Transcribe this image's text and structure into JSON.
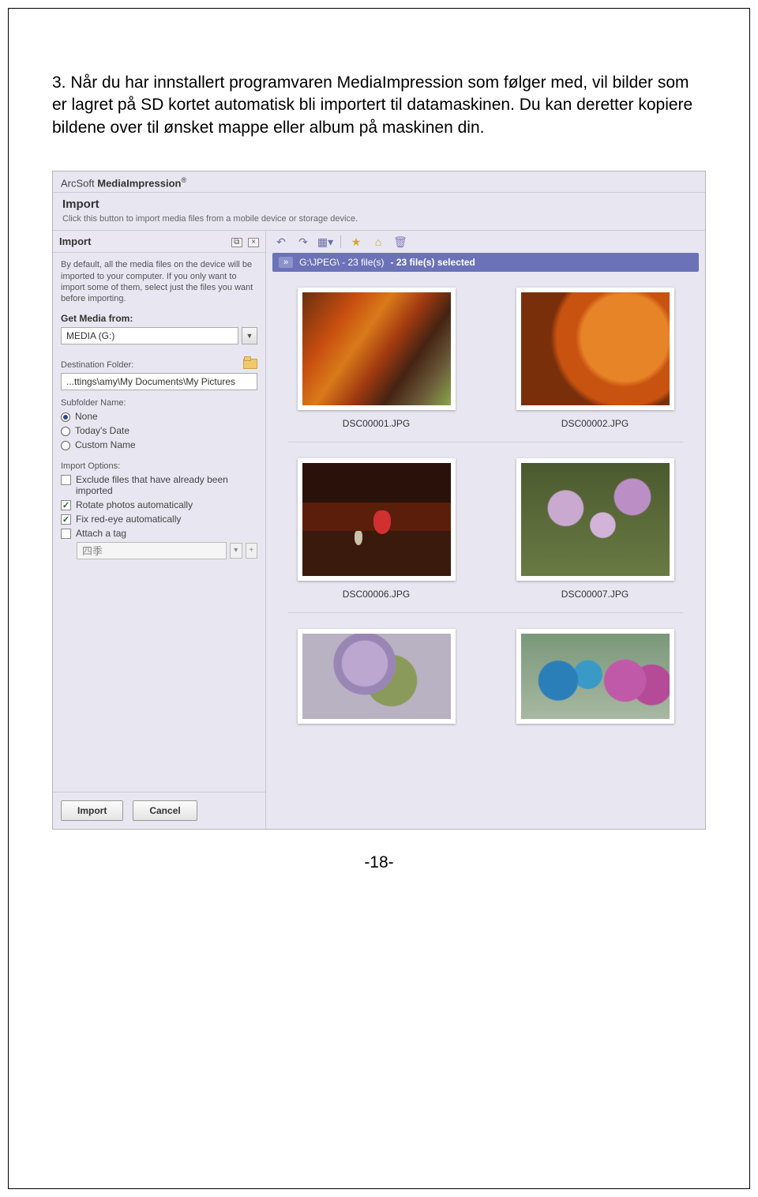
{
  "instruction": {
    "number": "3.",
    "text": "Når du har innstallert programvaren MediaImpression som følger med, vil  bilder som er lagret på SD kortet automatisk bli importert til datamaskinen. Du kan deretter kopiere bildene over til ønsket mappe eller album på maskinen din."
  },
  "page_number": "-18-",
  "app": {
    "title_brand": "ArcSoft",
    "title_product": "MediaImpression",
    "title_sup": "®",
    "section_title": "Import",
    "section_desc": "Click this button to import media files from a mobile device or storage device.",
    "panel": {
      "title": "Import",
      "help_text": "By default, all the media files on the device will be imported to your computer. If you only want to import some of them, select just the files you want before importing.",
      "get_media_label": "Get Media from:",
      "get_media_value": "MEDIA (G:)",
      "dest_label": "Destination Folder:",
      "dest_value": "...ttings\\amy\\My Documents\\My Pictures",
      "subfolder_label": "Subfolder Name:",
      "radios": {
        "none": "None",
        "today": "Today's Date",
        "custom": "Custom Name"
      },
      "options_label": "Import Options:",
      "checks": {
        "exclude": "Exclude files that have already been imported",
        "rotate": "Rotate photos automatically",
        "redeye": "Fix red-eye automatically",
        "attach": "Attach a tag"
      },
      "tag_placeholder": "四季",
      "btn_import": "Import",
      "btn_cancel": "Cancel"
    },
    "pathbar": {
      "chip": "»",
      "path": "G:\\JPEG\\ - 23 file(s)",
      "selected": "- 23 file(s) selected"
    },
    "thumbs": {
      "a": "DSC00001.JPG",
      "b": "DSC00002.JPG",
      "c": "DSC00006.JPG",
      "d": "DSC00007.JPG"
    }
  }
}
